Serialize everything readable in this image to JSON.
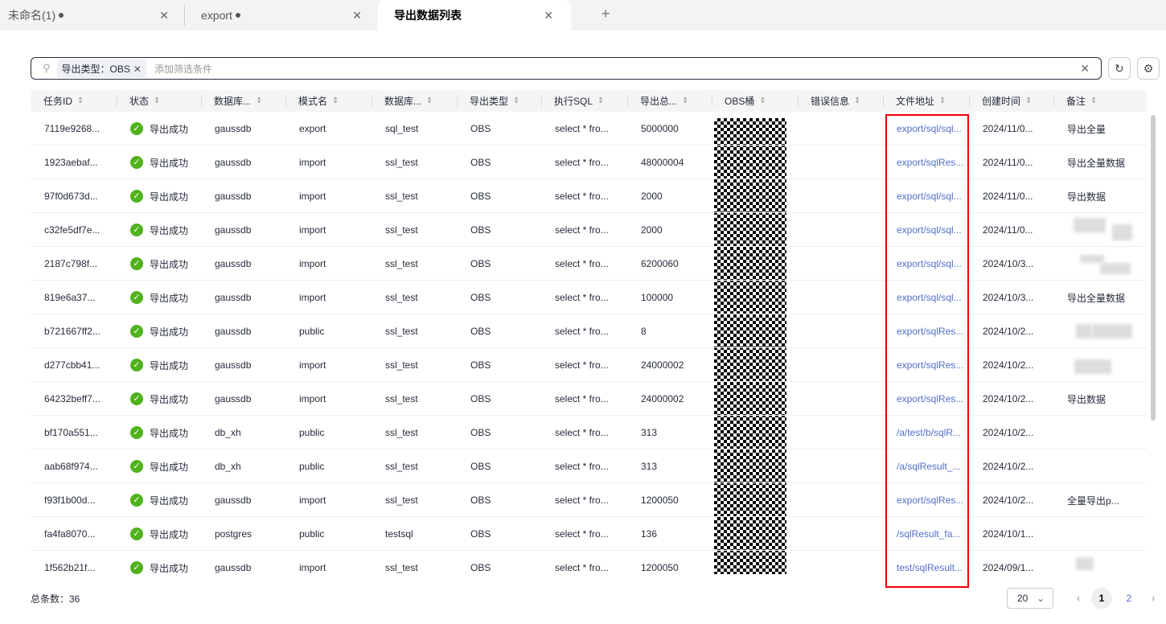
{
  "tabs": [
    {
      "label": "未命名(1)",
      "modified": true
    },
    {
      "label": "export",
      "modified": true
    },
    {
      "label": "导出数据列表",
      "modified": false
    }
  ],
  "filter": {
    "chip": "导出类型：OBS",
    "placeholder": "添加筛选条件"
  },
  "columns": [
    "任务ID",
    "状态",
    "数据库...",
    "模式名",
    "数据库...",
    "导出类型",
    "执行SQL",
    "导出总...",
    "OBS桶",
    "错误信息",
    "文件地址",
    "创建时间",
    "备注"
  ],
  "rows": [
    [
      "7119e9268...",
      "导出成功",
      "gaussdb",
      "export",
      "sql_test",
      "OBS",
      "select * fro...",
      "5000000",
      "",
      "",
      "export/sql/sql...",
      "2024/11/0...",
      "导出全量"
    ],
    [
      "1923aebaf...",
      "导出成功",
      "gaussdb",
      "import",
      "ssl_test",
      "OBS",
      "select * fro...",
      "48000004",
      "",
      "",
      "export/sqlRes...",
      "2024/11/0...",
      "导出全量数据"
    ],
    [
      "97f0d673d...",
      "导出成功",
      "gaussdb",
      "import",
      "ssl_test",
      "OBS",
      "select * fro...",
      "2000",
      "",
      "",
      "export/sql/sql...",
      "2024/11/0...",
      "导出数据"
    ],
    [
      "c32fe5df7e...",
      "导出成功",
      "gaussdb",
      "import",
      "ssl_test",
      "OBS",
      "select * fro...",
      "2000",
      "",
      "",
      "export/sql/sql...",
      "2024/11/0...",
      ""
    ],
    [
      "2187c798f...",
      "导出成功",
      "gaussdb",
      "import",
      "ssl_test",
      "OBS",
      "select * fro...",
      "6200060",
      "",
      "",
      "export/sql/sql...",
      "2024/10/3...",
      ""
    ],
    [
      "819e6a37...",
      "导出成功",
      "gaussdb",
      "import",
      "ssl_test",
      "OBS",
      "select * fro...",
      "100000",
      "",
      "",
      "export/sql/sql...",
      "2024/10/3...",
      "导出全量数据"
    ],
    [
      "b721667ff2...",
      "导出成功",
      "gaussdb",
      "public",
      "ssl_test",
      "OBS",
      "select * fro...",
      "8",
      "",
      "",
      "export/sqlRes...",
      "2024/10/2...",
      ""
    ],
    [
      "d277cbb41...",
      "导出成功",
      "gaussdb",
      "import",
      "ssl_test",
      "OBS",
      "select * fro...",
      "24000002",
      "",
      "",
      "export/sqlRes...",
      "2024/10/2...",
      ""
    ],
    [
      "64232beff7...",
      "导出成功",
      "gaussdb",
      "import",
      "ssl_test",
      "OBS",
      "select * fro...",
      "24000002",
      "",
      "",
      "export/sqlRes...",
      "2024/10/2...",
      "导出数据"
    ],
    [
      "bf170a551...",
      "导出成功",
      "db_xh",
      "public",
      "ssl_test",
      "OBS",
      "select * fro...",
      "313",
      "",
      "",
      "/a/test/b/sqlR...",
      "2024/10/2...",
      ""
    ],
    [
      "aab68f974...",
      "导出成功",
      "db_xh",
      "public",
      "ssl_test",
      "OBS",
      "select * fro...",
      "313",
      "",
      "",
      "/a/sqlResult_...",
      "2024/10/2...",
      ""
    ],
    [
      "f93f1b00d...",
      "导出成功",
      "gaussdb",
      "import",
      "ssl_test",
      "OBS",
      "select * fro...",
      "1200050",
      "",
      "",
      "export/sqlRes...",
      "2024/10/2...",
      "全量导出p..."
    ],
    [
      "fa4fa8070...",
      "导出成功",
      "postgres",
      "public",
      "testsql",
      "OBS",
      "select * fro...",
      "136",
      "",
      "",
      "/sqlResult_fa...",
      "2024/10/1...",
      ""
    ],
    [
      "1f562b21f...",
      "导出成功",
      "gaussdb",
      "import",
      "ssl_test",
      "OBS",
      "select * fro...",
      "1200050",
      "",
      "",
      "test/sqlResult...",
      "2024/09/1...",
      ""
    ]
  ],
  "footer": {
    "total": "总条数：36",
    "page_size": "20",
    "pages": [
      "1",
      "2"
    ],
    "current_page": "1"
  },
  "colors": {
    "success": "#50b21c",
    "link": "#526ecc",
    "highlight": "#e00000"
  }
}
